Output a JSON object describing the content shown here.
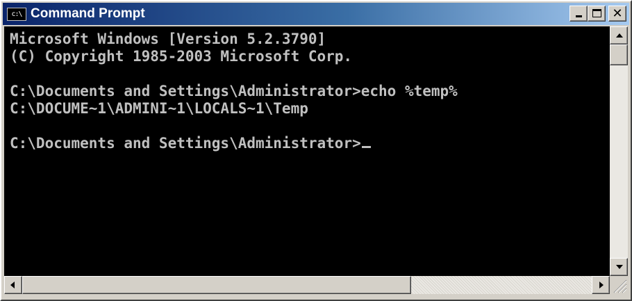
{
  "window": {
    "title": "Command Prompt",
    "icon": "cmd-icon",
    "icon_label": "c:\\"
  },
  "console": {
    "lines": [
      "Microsoft Windows [Version 5.2.3790]",
      "(C) Copyright 1985-2003 Microsoft Corp.",
      "",
      "C:\\Documents and Settings\\Administrator>echo %temp%",
      "C:\\DOCUME~1\\ADMINI~1\\LOCALS~1\\Temp",
      "",
      "C:\\Documents and Settings\\Administrator>"
    ],
    "text_color": "#c0c0c0",
    "background": "#000000"
  },
  "colors": {
    "titlebar_start": "#0a246a",
    "titlebar_end": "#a6caf0",
    "chrome": "#d4d0c8"
  }
}
